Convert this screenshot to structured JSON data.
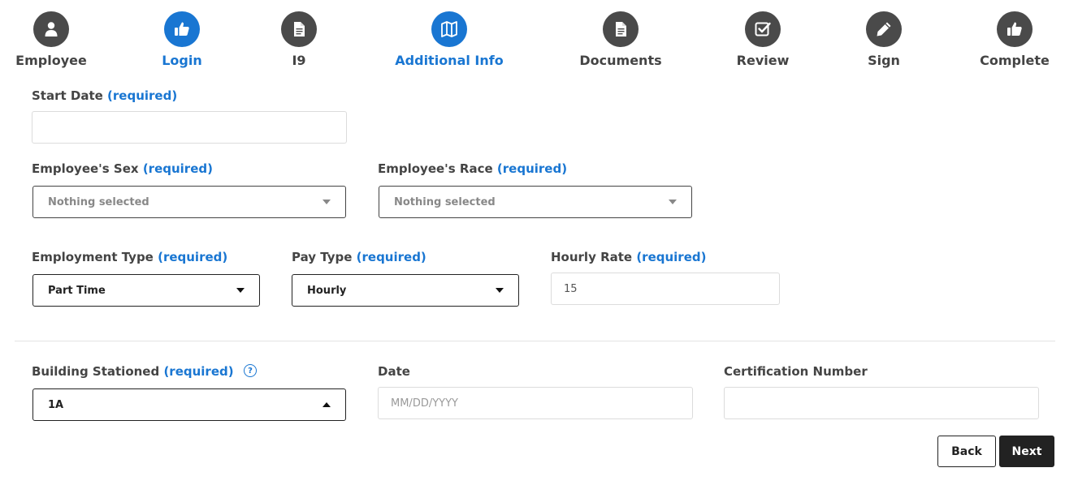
{
  "steps": [
    {
      "label": "Employee",
      "icon": "user-icon",
      "active": false
    },
    {
      "label": "Login",
      "icon": "thumbs-up-icon",
      "active": true
    },
    {
      "label": "I9",
      "icon": "document-icon",
      "active": false
    },
    {
      "label": "Additional Info",
      "icon": "map-icon",
      "active": true
    },
    {
      "label": "Documents",
      "icon": "document-icon",
      "active": false
    },
    {
      "label": "Review",
      "icon": "check-square-icon",
      "active": false
    },
    {
      "label": "Sign",
      "icon": "pencil-icon",
      "active": false
    },
    {
      "label": "Complete",
      "icon": "thumbs-up-icon",
      "active": false
    }
  ],
  "required_tag": "(required)",
  "form": {
    "start_date": {
      "label": "Start Date",
      "value": ""
    },
    "sex": {
      "label": "Employee's Sex",
      "value": "Nothing selected"
    },
    "race": {
      "label": "Employee's Race",
      "value": "Nothing selected"
    },
    "employment_type": {
      "label": "Employment Type",
      "value": "Part Time"
    },
    "pay_type": {
      "label": "Pay Type",
      "value": "Hourly"
    },
    "hourly_rate": {
      "label": "Hourly Rate",
      "value": "15"
    },
    "building": {
      "label": "Building Stationed",
      "value": "1A",
      "help_icon": "question-circle-icon"
    },
    "date": {
      "label": "Date",
      "placeholder": "MM/DD/YYYY",
      "value": ""
    },
    "certification": {
      "label": "Certification Number",
      "value": ""
    }
  },
  "buttons": {
    "back": "Back",
    "next": "Next"
  },
  "colors": {
    "accent": "#1976d2",
    "step_inactive": "#4a4a4a",
    "primary_button": "#222222"
  }
}
